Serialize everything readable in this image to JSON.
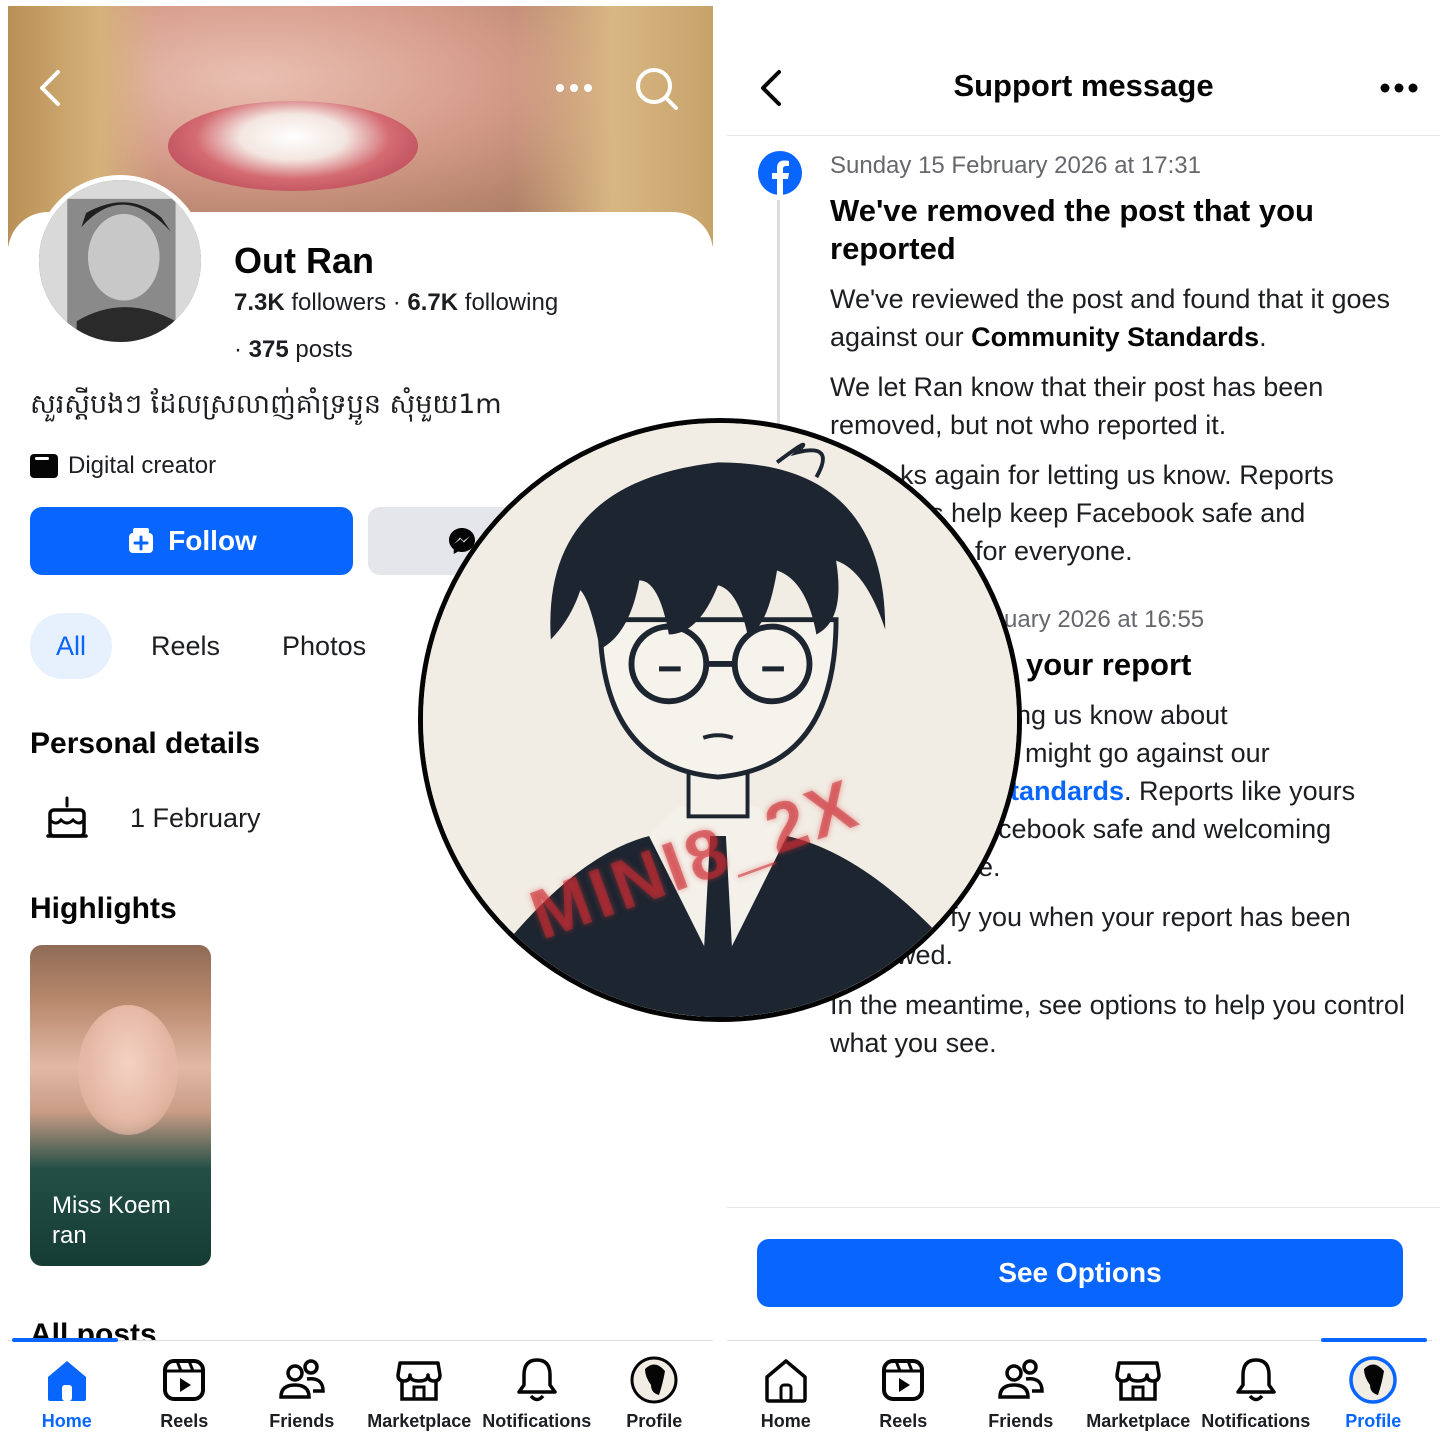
{
  "left": {
    "profile": {
      "name": "Out Ran",
      "followers_count": "7.3K",
      "followers_label": " followers",
      "sep": " · ",
      "following_count": "6.7K",
      "following_label": " following",
      "posts_prefix": "· ",
      "posts_count": "375",
      "posts_label": " posts",
      "bio": "សួរស្តីបងៗ ដែលស្រលាញ់គាំទ្រប្អូន សុំមួយ1m",
      "category": "Digital creator"
    },
    "buttons": {
      "follow": "Follow"
    },
    "tabs": [
      "All",
      "Reels",
      "Photos"
    ],
    "personal_details": {
      "title": "Personal details",
      "birthday": "1 February"
    },
    "highlights": {
      "title": "Highlights",
      "items": [
        {
          "label": "Miss Koem ran"
        }
      ]
    },
    "all_posts_title": "All posts"
  },
  "right": {
    "header": {
      "title": "Support message"
    },
    "message1": {
      "timestamp": "Sunday 15 February 2026 at 17:31",
      "heading": "We've removed the post that you reported",
      "p1_text": "We've reviewed the post and found that it goes against our ",
      "p1_bold": "Community Standards",
      "p1_end": ".",
      "p2": "We let Ran know that their post has been removed, but not who reported it.",
      "p3": "ks again for letting us know. Reports",
      "p3b": "s help keep Facebook safe and",
      "p3c": "for everyone."
    },
    "message2": {
      "timestamp": "uary 2026 at 16:55",
      "heading": "your report",
      "p1a": "ing us know about",
      "p1b": "t might go against our",
      "p1c_link": "tandards",
      "p1c_rest": ". Reports like yours",
      "p1d": "cebook safe and welcoming",
      "p1e": "e.",
      "p2a": "fy you when your report has been",
      "p2b": "wed.",
      "p3": "In the meantime, see options to help you control what you see."
    },
    "buttons": {
      "see_options": "See Options"
    }
  },
  "tabbar": {
    "items": [
      "Home",
      "Reels",
      "Friends",
      "Marketplace",
      "Notifications",
      "Profile"
    ]
  },
  "watermark": {
    "text": "MINI8_2X"
  },
  "colors": {
    "accent": "#0866ff",
    "text": "#050505",
    "secondary": "#65676b",
    "button_grey": "#e4e6eb"
  }
}
